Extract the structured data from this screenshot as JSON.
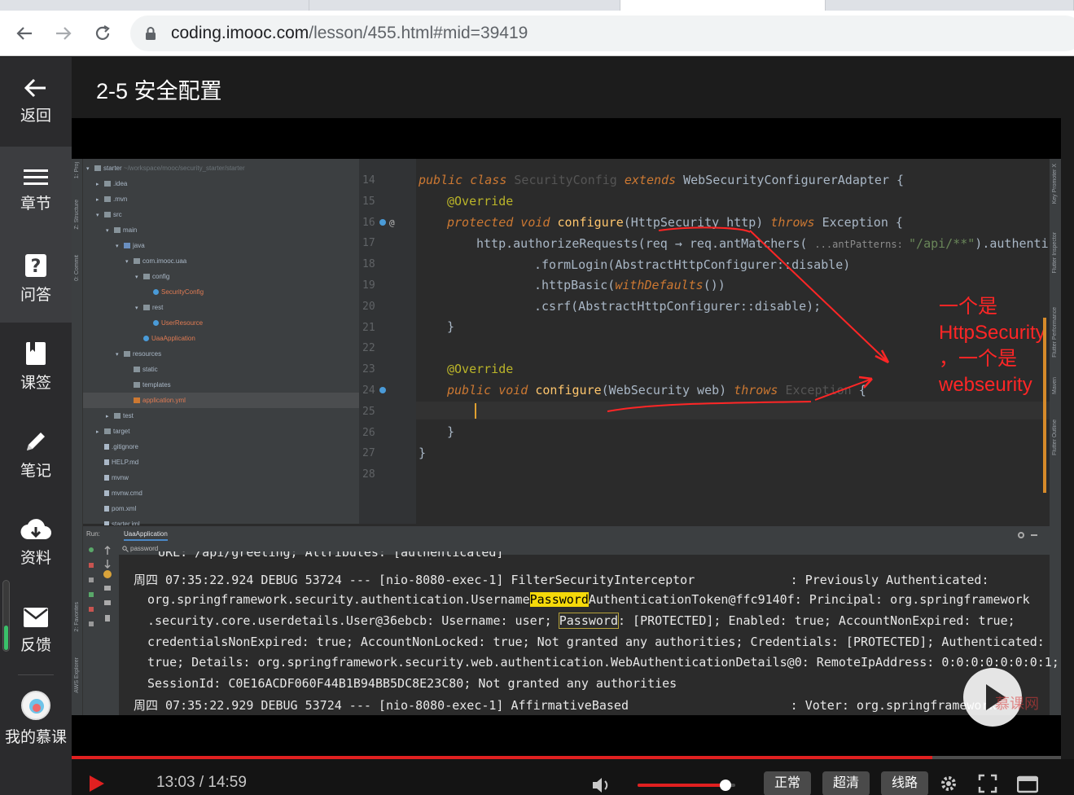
{
  "browser": {
    "url_host": "coding.imooc.com",
    "url_path": "/lesson/455.html#mid=39419"
  },
  "sidebar": {
    "items": [
      {
        "label": "返回",
        "icon": "back-arrow-icon"
      },
      {
        "label": "章节",
        "icon": "menu-icon"
      },
      {
        "label": "问答",
        "icon": "question-icon"
      },
      {
        "label": "课签",
        "icon": "bookmark-icon"
      },
      {
        "label": "笔记",
        "icon": "pencil-icon"
      },
      {
        "label": "资料",
        "icon": "cloud-download-icon"
      },
      {
        "label": "反馈",
        "icon": "mail-icon"
      },
      {
        "label": "我的慕课",
        "icon": "avatar"
      }
    ]
  },
  "page": {
    "title": "2-5 安全配置"
  },
  "video": {
    "project_tree": [
      {
        "depth": 0,
        "arrow": "▾",
        "icon": "folder",
        "text": "starter",
        "note": "~/workspace/mooc/security_starter/starter"
      },
      {
        "depth": 1,
        "arrow": "▸",
        "icon": "folder",
        "text": ".idea"
      },
      {
        "depth": 1,
        "arrow": "▸",
        "icon": "folder",
        "text": ".mvn"
      },
      {
        "depth": 1,
        "arrow": "▾",
        "icon": "folder",
        "text": "src"
      },
      {
        "depth": 2,
        "arrow": "▾",
        "icon": "folder",
        "text": "main"
      },
      {
        "depth": 3,
        "arrow": "▾",
        "icon": "folder blue",
        "text": "java"
      },
      {
        "depth": 4,
        "arrow": "▾",
        "icon": "folder",
        "text": "com.imooc.uaa"
      },
      {
        "depth": 5,
        "arrow": "▾",
        "icon": "folder",
        "text": "config"
      },
      {
        "depth": 6,
        "arrow": "",
        "icon": "java",
        "text": "SecurityConfig",
        "orange": true
      },
      {
        "depth": 5,
        "arrow": "▾",
        "icon": "folder",
        "text": "rest"
      },
      {
        "depth": 6,
        "arrow": "",
        "icon": "java",
        "text": "UserResource",
        "orange": true
      },
      {
        "depth": 5,
        "arrow": "",
        "icon": "java",
        "text": "UaaApplication",
        "orange": true
      },
      {
        "depth": 3,
        "arrow": "▾",
        "icon": "folder",
        "text": "resources"
      },
      {
        "depth": 4,
        "arrow": "",
        "icon": "folder",
        "text": "static"
      },
      {
        "depth": 4,
        "arrow": "",
        "icon": "folder",
        "text": "templates"
      },
      {
        "depth": 4,
        "arrow": "",
        "icon": "yml",
        "text": "application.yml",
        "orange": true,
        "selected": true
      },
      {
        "depth": 2,
        "arrow": "▸",
        "icon": "folder",
        "text": "test"
      },
      {
        "depth": 1,
        "arrow": "▸",
        "icon": "folder",
        "text": "target"
      },
      {
        "depth": 1,
        "arrow": "",
        "icon": "file",
        "text": ".gitignore"
      },
      {
        "depth": 1,
        "arrow": "",
        "icon": "file",
        "text": "HELP.md"
      },
      {
        "depth": 1,
        "arrow": "",
        "icon": "file",
        "text": "mvnw"
      },
      {
        "depth": 1,
        "arrow": "",
        "icon": "file",
        "text": "mvnw.cmd"
      },
      {
        "depth": 1,
        "arrow": "",
        "icon": "file",
        "text": "pom.xml"
      },
      {
        "depth": 1,
        "arrow": "",
        "icon": "file",
        "text": "starter.iml"
      }
    ],
    "line_numbers": [
      "14",
      "15",
      "16",
      "17",
      "18",
      "19",
      "20",
      "21",
      "22",
      "23",
      "24",
      "25",
      "26",
      "27",
      "28"
    ],
    "code": {
      "l14": {
        "kw1": "public class ",
        "dim": "SecurityConfig ",
        "kw2": "extends ",
        "rest": "WebSecurityConfigurerAdapter {"
      },
      "l15": "@Override",
      "l16": {
        "kw1": "protected void ",
        "m": "configure",
        "p1": "(HttpSecurity http) ",
        "kw2": "throws ",
        "rest": "Exception {"
      },
      "l17": {
        "a": "http.authorizeRequests(req → req.antMatchers( ",
        "hint": "...antPatterns: ",
        "s": "\"/api/**\"",
        "b": ").authenticat"
      },
      "l18": ".formLogin(AbstractHttpConfigurer::disable)",
      "l19": {
        "a": ".httpBasic(",
        "kw": "withDefaults",
        "b": "())"
      },
      "l20": ".csrf(AbstractHttpConfigurer::disable);",
      "l21": "}",
      "l23": "@Override",
      "l24": {
        "kw1": "public void ",
        "m": "configure",
        "p1": "(WebSecurity web) ",
        "kw2": "throws ",
        "dim": "Exception",
        "rest": " {"
      },
      "l26": "}",
      "l27": "}"
    },
    "annotation_lines": [
      "一个是",
      "HttpSecurity",
      "，一个是",
      "webseurity"
    ],
    "run_bar": {
      "run_label": "Run:",
      "tab_label": "UaaApplication",
      "search_text": "password"
    },
    "console_lines": [
      "URL: /api/greeting; Attributes: [authenticated]",
      "周四 07:35:22.924 DEBUG 53724 --- [nio-8080-exec-1] FilterSecurityInterceptor             : Previously Authenticated:",
      {
        "pre": "org.springframework.security.authentication.Username",
        "hl": "Password",
        "post": "AuthenticationToken@ffc9140f: Principal: org.springframework"
      },
      {
        "pre": ".security.core.userdetails.User@36ebcb: Username: user; ",
        "hl": "Password",
        "post": ": [PROTECTED]; Enabled: true; AccountNonExpired: true;"
      },
      "credentialsNonExpired: true; AccountNonLocked: true; Not granted any authorities; Credentials: [PROTECTED]; Authenticated:",
      "true; Details: org.springframework.security.web.authentication.WebAuthenticationDetails@0: RemoteIpAddress: 0:0:0:0:0:0:0:1;",
      "SessionId: C0E16ACDF060F44B1B94BB5DC8E23C80; Not granted any authorities",
      "周四 07:35:22.929 DEBUG 53724 --- [nio-8080-exec-1] AffirmativeBased                      : Voter: org.springframework"
    ],
    "watermark": "慕课网"
  },
  "player": {
    "time": "13:03 / 14:59",
    "progress": 0.87,
    "volume": 0.9,
    "btn_normal": "正常",
    "btn_hd": "超清",
    "btn_route": "线路",
    "accent": "#e02020"
  }
}
